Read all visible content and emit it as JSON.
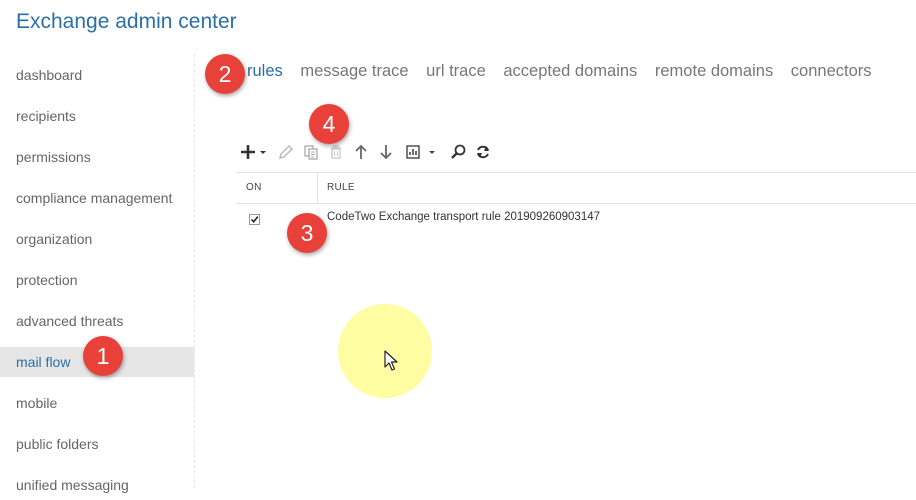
{
  "app": {
    "title": "Exchange admin center"
  },
  "sidebar": {
    "items": [
      {
        "label": "dashboard"
      },
      {
        "label": "recipients"
      },
      {
        "label": "permissions"
      },
      {
        "label": "compliance management"
      },
      {
        "label": "organization"
      },
      {
        "label": "protection"
      },
      {
        "label": "advanced threats"
      },
      {
        "label": "mail flow",
        "active": true
      },
      {
        "label": "mobile"
      },
      {
        "label": "public folders"
      },
      {
        "label": "unified messaging"
      }
    ]
  },
  "tabs": [
    {
      "label": "rules",
      "active": true
    },
    {
      "label": "message trace"
    },
    {
      "label": "url trace"
    },
    {
      "label": "accepted domains"
    },
    {
      "label": "remote domains"
    },
    {
      "label": "connectors"
    }
  ],
  "toolbar": {
    "buttons": [
      {
        "icon": "plus-icon",
        "dropdown": true
      },
      {
        "icon": "pencil-icon"
      },
      {
        "icon": "copy-icon"
      },
      {
        "icon": "trash-icon"
      },
      {
        "icon": "arrow-up-icon"
      },
      {
        "icon": "arrow-down-icon"
      },
      {
        "icon": "report-icon",
        "dropdown": true
      },
      {
        "icon": "search-icon"
      },
      {
        "icon": "refresh-icon"
      }
    ]
  },
  "grid": {
    "columns": {
      "on": "ON",
      "rule": "RULE"
    },
    "rows": [
      {
        "on": true,
        "rule": "CodeTwo Exchange transport rule 201909260903147"
      }
    ]
  },
  "annotations": [
    {
      "number": "1"
    },
    {
      "number": "2"
    },
    {
      "number": "3"
    },
    {
      "number": "4"
    }
  ],
  "colors": {
    "accent": "#2a6fa8",
    "badge": "#e8413a",
    "active_nav_bg": "#e6e6e6",
    "cursor_halo": "#fffd91"
  }
}
